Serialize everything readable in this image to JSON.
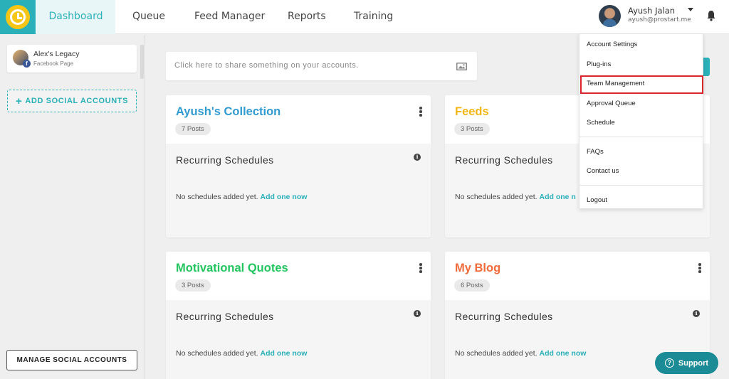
{
  "nav": {
    "items": [
      "Dashboard",
      "Queue",
      "Feed Manager",
      "Reports",
      "Training"
    ],
    "active": "Dashboard"
  },
  "user": {
    "name": "Ayush Jalan",
    "email": "ayush@prostart.me"
  },
  "sidebar": {
    "account": {
      "name": "Alex's Legacy",
      "type": "Facebook Page"
    },
    "add_button": "ADD SOCIAL ACCOUNTS",
    "manage_button": "MANAGE SOCIAL ACCOUNTS"
  },
  "share": {
    "placeholder": "Click here to share something on your accounts."
  },
  "cards": [
    {
      "title": "Ayush's Collection",
      "posts": "7 Posts",
      "color": "#2f9bd1",
      "section": "Recurring Schedules",
      "empty": "No schedules added yet.",
      "link": "Add one now"
    },
    {
      "title": "Feeds",
      "posts": "3 Posts",
      "color": "#f2b714",
      "section": "Recurring Schedules",
      "empty": "No schedules added yet.",
      "link": "Add one n"
    },
    {
      "title": "Motivational Quotes",
      "posts": "3 Posts",
      "color": "#22c55e",
      "section": "Recurring Schedules",
      "empty": "No schedules added yet.",
      "link": "Add one now"
    },
    {
      "title": "My Blog",
      "posts": "6 Posts",
      "color": "#f06a3a",
      "section": "Recurring Schedules",
      "empty": "No schedules added yet.",
      "link": "Add one now"
    }
  ],
  "dropdown": {
    "items": [
      "Account Settings",
      "Plug-ins",
      "Team Management",
      "Approval Queue",
      "Schedule",
      "FAQs",
      "Contact us",
      "Logout"
    ],
    "highlighted": "Team Management"
  },
  "support": {
    "label": "Support"
  },
  "colors": {
    "accent": "#2ab0b8",
    "highlight": "#d8262c"
  }
}
